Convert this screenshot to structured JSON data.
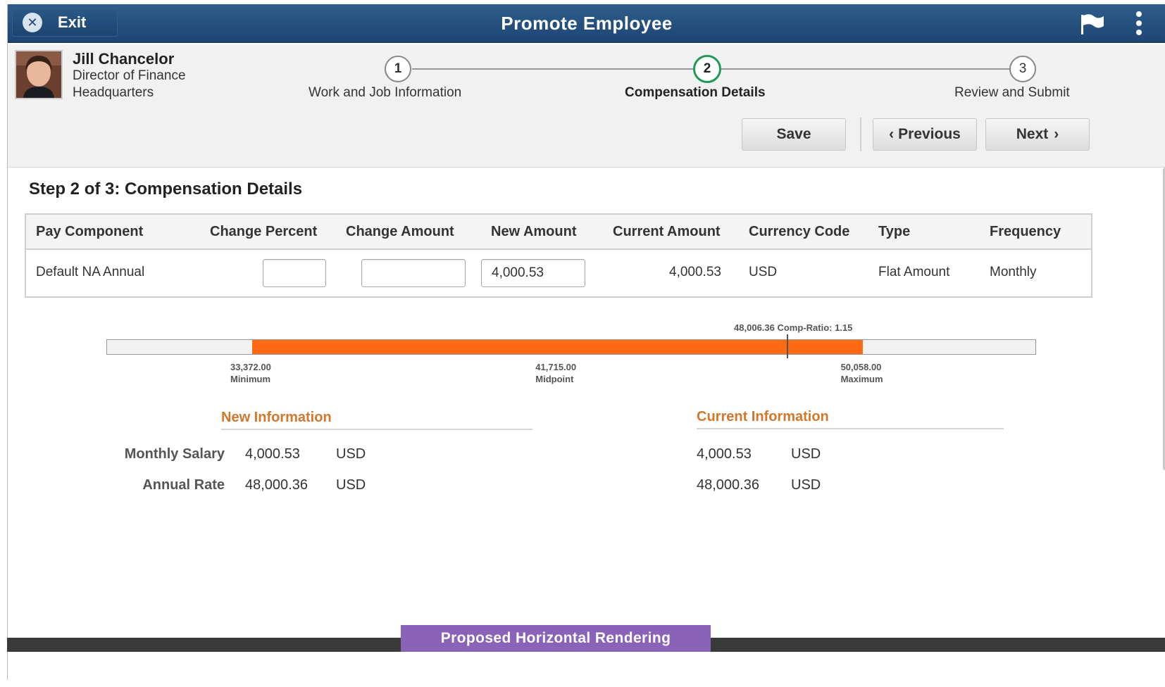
{
  "titlebar": {
    "exit_label": "Exit",
    "title": "Promote Employee"
  },
  "employee": {
    "name": "Jill Chancelor",
    "title": "Director of Finance",
    "location": "Headquarters"
  },
  "steps": [
    {
      "number": "1",
      "label": "Work and Job Information",
      "state": "done"
    },
    {
      "number": "2",
      "label": "Compensation Details",
      "state": "active"
    },
    {
      "number": "3",
      "label": "Review and Submit",
      "state": "pending"
    }
  ],
  "toolbar": {
    "save_label": "Save",
    "previous_label": "Previous",
    "next_label": "Next"
  },
  "main": {
    "heading": "Step 2 of 3: Compensation Details",
    "columns": [
      "Pay Component",
      "Change Percent",
      "Change Amount",
      "New Amount",
      "Current Amount",
      "Currency Code",
      "Type",
      "Frequency"
    ],
    "row": {
      "pay_component": "Default NA Annual",
      "change_percent": "",
      "change_amount": "",
      "new_amount": "4,000.53",
      "current_amount": "4,000.53",
      "currency_code": "USD",
      "type": "Flat Amount",
      "frequency": "Monthly"
    }
  },
  "range": {
    "min_value": "33,372.00",
    "min_label": "Minimum",
    "mid_value": "41,715.00",
    "mid_label": "Midpoint",
    "max_value": "50,058.00",
    "max_label": "Maximum",
    "marker_label": "48,006.36 Comp-Ratio: 1.15",
    "min": 33372.0,
    "mid": 41715.0,
    "max": 50058.0,
    "current": 48006.36,
    "fill_color": "#ff6a13"
  },
  "new_info": {
    "title": "New Information",
    "rows": [
      {
        "label": "Monthly Salary",
        "value": "4,000.53",
        "currency": "USD"
      },
      {
        "label": "Annual Rate",
        "value": "48,000.36",
        "currency": "USD"
      }
    ]
  },
  "current_info": {
    "title": "Current Information",
    "rows": [
      {
        "value": "4,000.53",
        "currency": "USD"
      },
      {
        "value": "48,000.36",
        "currency": "USD"
      }
    ]
  },
  "footer": {
    "tab_label": "Proposed Horizontal Rendering"
  },
  "colors": {
    "titlebar": "#1d4674",
    "accent_orange": "#d0782d",
    "active_step": "#1e9a55",
    "footer_tab": "#8a63b8"
  },
  "icons": {
    "exit": "close-circle-icon",
    "flag": "flag-icon",
    "more": "vertical-dots-icon",
    "avatar": "employee-photo"
  }
}
